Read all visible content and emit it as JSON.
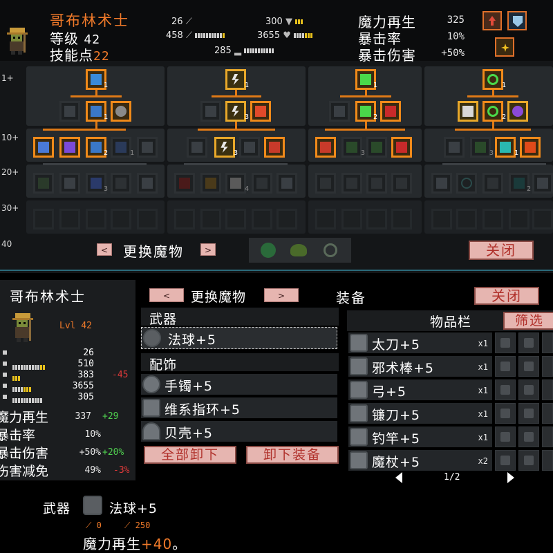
{
  "top": {
    "character_name": "哥布林术士",
    "level_label": "等级",
    "level_value": "42",
    "skill_points_label": "技能点",
    "skill_points_value": "22",
    "mini_stats": [
      {
        "value": "26",
        "icon": "sword-icon"
      },
      {
        "value": "458",
        "icon": "staff-icon"
      },
      {
        "value": "285",
        "icon": "boot-icon"
      },
      {
        "value": "300",
        "icon": "shield-icon"
      },
      {
        "value": "3655",
        "icon": "heart-icon"
      }
    ],
    "right_stats": [
      {
        "label": "魔力再生",
        "value": "325"
      },
      {
        "label": "暴击率",
        "value": "10%"
      },
      {
        "label": "暴击伤害",
        "value": "+50%"
      }
    ],
    "tiers": [
      "1+",
      "10+",
      "20+",
      "30+",
      "40"
    ],
    "skill_levels": {
      "g1_top": "1",
      "g1_mid": "1",
      "g1_r2c3": "2",
      "g1_r2c4": "1",
      "g1_r3c3": "3",
      "g2_top": "1",
      "g2_mid": "3",
      "g2_r2c2": "3",
      "g2_r3c3": "4",
      "g3_top": "1",
      "g3_mid": "2",
      "g3_r2c2": "3",
      "g4_top": "1",
      "g4_mid": "2",
      "g4_r2c2": "3",
      "g4_r2c3": "1",
      "g4_r3c4": "2"
    },
    "change_monster_label": "更换魔物",
    "prev_label": "<",
    "next_label": ">",
    "close_label": "关闭",
    "accent_color": "#f07a2a"
  },
  "bottom": {
    "character_name": "哥布林术士",
    "level": "Lvl 42",
    "stats": [
      {
        "value": "26"
      },
      {
        "value": "510"
      },
      {
        "value": "383",
        "diff": "-45"
      },
      {
        "value": "3655"
      },
      {
        "value": "305"
      }
    ],
    "named_stats": [
      {
        "label": "魔力再生",
        "value": "337",
        "diff": "+29"
      },
      {
        "label": "暴击率",
        "value": "10%",
        "diff": ""
      },
      {
        "label": "暴击伤害",
        "value": "+50%",
        "diff": "+20%"
      },
      {
        "label": "伤害减免",
        "value": "49%",
        "diff": "-3%"
      }
    ],
    "change_monster_label": "更换魔物",
    "prev_label": "<",
    "next_label": ">",
    "equipment_title": "装备",
    "close_label": "关闭",
    "weapon_label": "武器",
    "weapon_item": "法球+5",
    "accessory_label": "配饰",
    "accessories": [
      "手镯+5",
      "维系指环+5",
      "贝壳+5"
    ],
    "unequip_all_label": "全部卸下",
    "unequip_label": "卸下装备",
    "inventory_title": "物品栏",
    "filter_label": "筛选",
    "inventory": [
      {
        "name": "太刀+5",
        "qty": "x1"
      },
      {
        "name": "邪术棒+5",
        "qty": "x1"
      },
      {
        "name": "弓+5",
        "qty": "x1"
      },
      {
        "name": "镰刀+5",
        "qty": "x1"
      },
      {
        "name": "钓竿+5",
        "qty": "x1"
      },
      {
        "name": "魔杖+5",
        "qty": "x2"
      }
    ],
    "page": "1/2",
    "tooltip": {
      "type_label": "武器",
      "item": "法球+5",
      "attack": "0",
      "magic": "250",
      "effect_prefix": "魔力再生",
      "effect_value": "+40",
      "effect_suffix": "。"
    }
  }
}
